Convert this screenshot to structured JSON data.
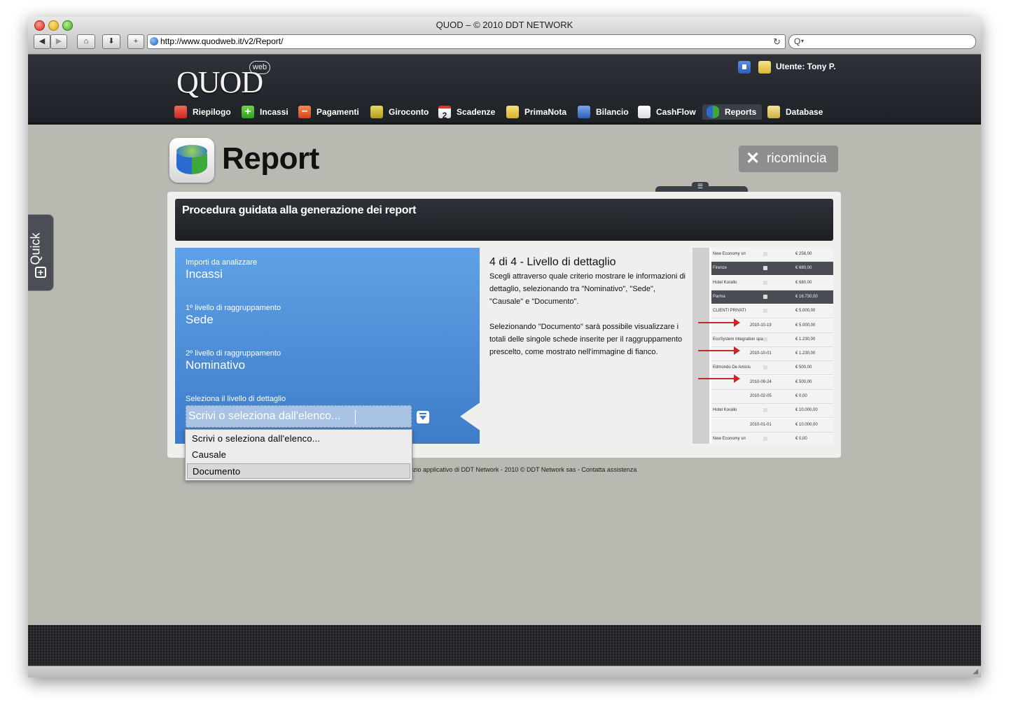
{
  "browser": {
    "title": "QUOD – © 2010 DDT NETWORK",
    "url": "http://www.quodweb.it/v2/Report/",
    "search_placeholder": "Q"
  },
  "header": {
    "logo_text": "QUOD",
    "logo_badge": "web",
    "user_label": "Utente: Tony P."
  },
  "nav": {
    "items": [
      {
        "label": "Riepilogo"
      },
      {
        "label": "Incassi"
      },
      {
        "label": "Pagamenti"
      },
      {
        "label": "Giroconto"
      },
      {
        "label": "Scadenze"
      },
      {
        "label": "PrimaNota"
      },
      {
        "label": "Bilancio"
      },
      {
        "label": "CashFlow"
      },
      {
        "label": "Reports"
      },
      {
        "label": "Database"
      }
    ],
    "active": "Reports"
  },
  "page": {
    "title": "Report",
    "restart_label": "ricomincia",
    "quick_label": "Quick"
  },
  "wizard": {
    "header": "Procedura guidata alla generazione dei report",
    "fields": [
      {
        "label": "Importi da analizzare",
        "value": "Incassi"
      },
      {
        "label": "1º livello di raggruppamento",
        "value": "Sede"
      },
      {
        "label": "2º livello di raggruppamento",
        "value": "Nominativo"
      }
    ],
    "select_label": "Seleziona il livello di dettaglio",
    "select_value": "Scrivi o seleziona dall'elenco...",
    "step_title": "4 di 4 - Livello di dettaglio",
    "step_desc1": "Scegli attraverso quale criterio mostrare le informazioni di dettaglio, selezionando tra \"Nominativo\", \"Sede\", \"Causale\" e \"Documento\".",
    "step_desc2": "Selezionando \"Documento\" sarà possibile visualizzare i totali delle singole schede inserite per il raggruppamento prescelto, come mostrato nell'immagine di fianco."
  },
  "dropdown": {
    "options": [
      "Scrivi o seleziona dall'elenco...",
      "Causale",
      "Documento"
    ],
    "selected": "Documento"
  },
  "preview_rows": [
    {
      "kind": "light",
      "name": "New Economy srl",
      "date": "",
      "amount": "€ 256,00"
    },
    {
      "kind": "dark",
      "name": "Firenze",
      "date": "",
      "amount": "€ 680,00"
    },
    {
      "kind": "light",
      "name": "Hotel Korallo",
      "date": "",
      "amount": "€ 680,00"
    },
    {
      "kind": "dark",
      "name": "Parma",
      "date": "",
      "amount": "€ 16.730,00"
    },
    {
      "kind": "light",
      "name": "CLIENTI PRIVATI",
      "date": "",
      "amount": "€ 5.000,00"
    },
    {
      "kind": "light",
      "name": "",
      "date": "2010-10-19",
      "amount": "€ 5.000,00"
    },
    {
      "kind": "light",
      "name": "EcoSystem Integration spa",
      "date": "",
      "amount": "€ 1.230,00"
    },
    {
      "kind": "light",
      "name": "",
      "date": "2010-10-01",
      "amount": "€ 1.230,00"
    },
    {
      "kind": "light",
      "name": "Edmondo De Amicis",
      "date": "",
      "amount": "€ 500,00"
    },
    {
      "kind": "light",
      "name": "",
      "date": "2010-09-24",
      "amount": "€ 500,00"
    },
    {
      "kind": "light",
      "name": "",
      "date": "2010-02-05",
      "amount": "€ 0,00"
    },
    {
      "kind": "light",
      "name": "Hotel Korallo",
      "date": "",
      "amount": "€ 10.000,00"
    },
    {
      "kind": "light",
      "name": "",
      "date": "2010-01-01",
      "amount": "€ 10.000,00"
    },
    {
      "kind": "light",
      "name": "New Economy srl",
      "date": "",
      "amount": "€ 0,00"
    }
  ],
  "footer": {
    "note": "izio applicativo di DDT Network - 2010 © DDT Network sas - Contatta assistenza"
  },
  "colors": {
    "header_bg": "#2e3238",
    "wizard_blue": "#4f8fd8",
    "page_bg": "#b9b8b1",
    "arrow_red": "#c8262a"
  }
}
